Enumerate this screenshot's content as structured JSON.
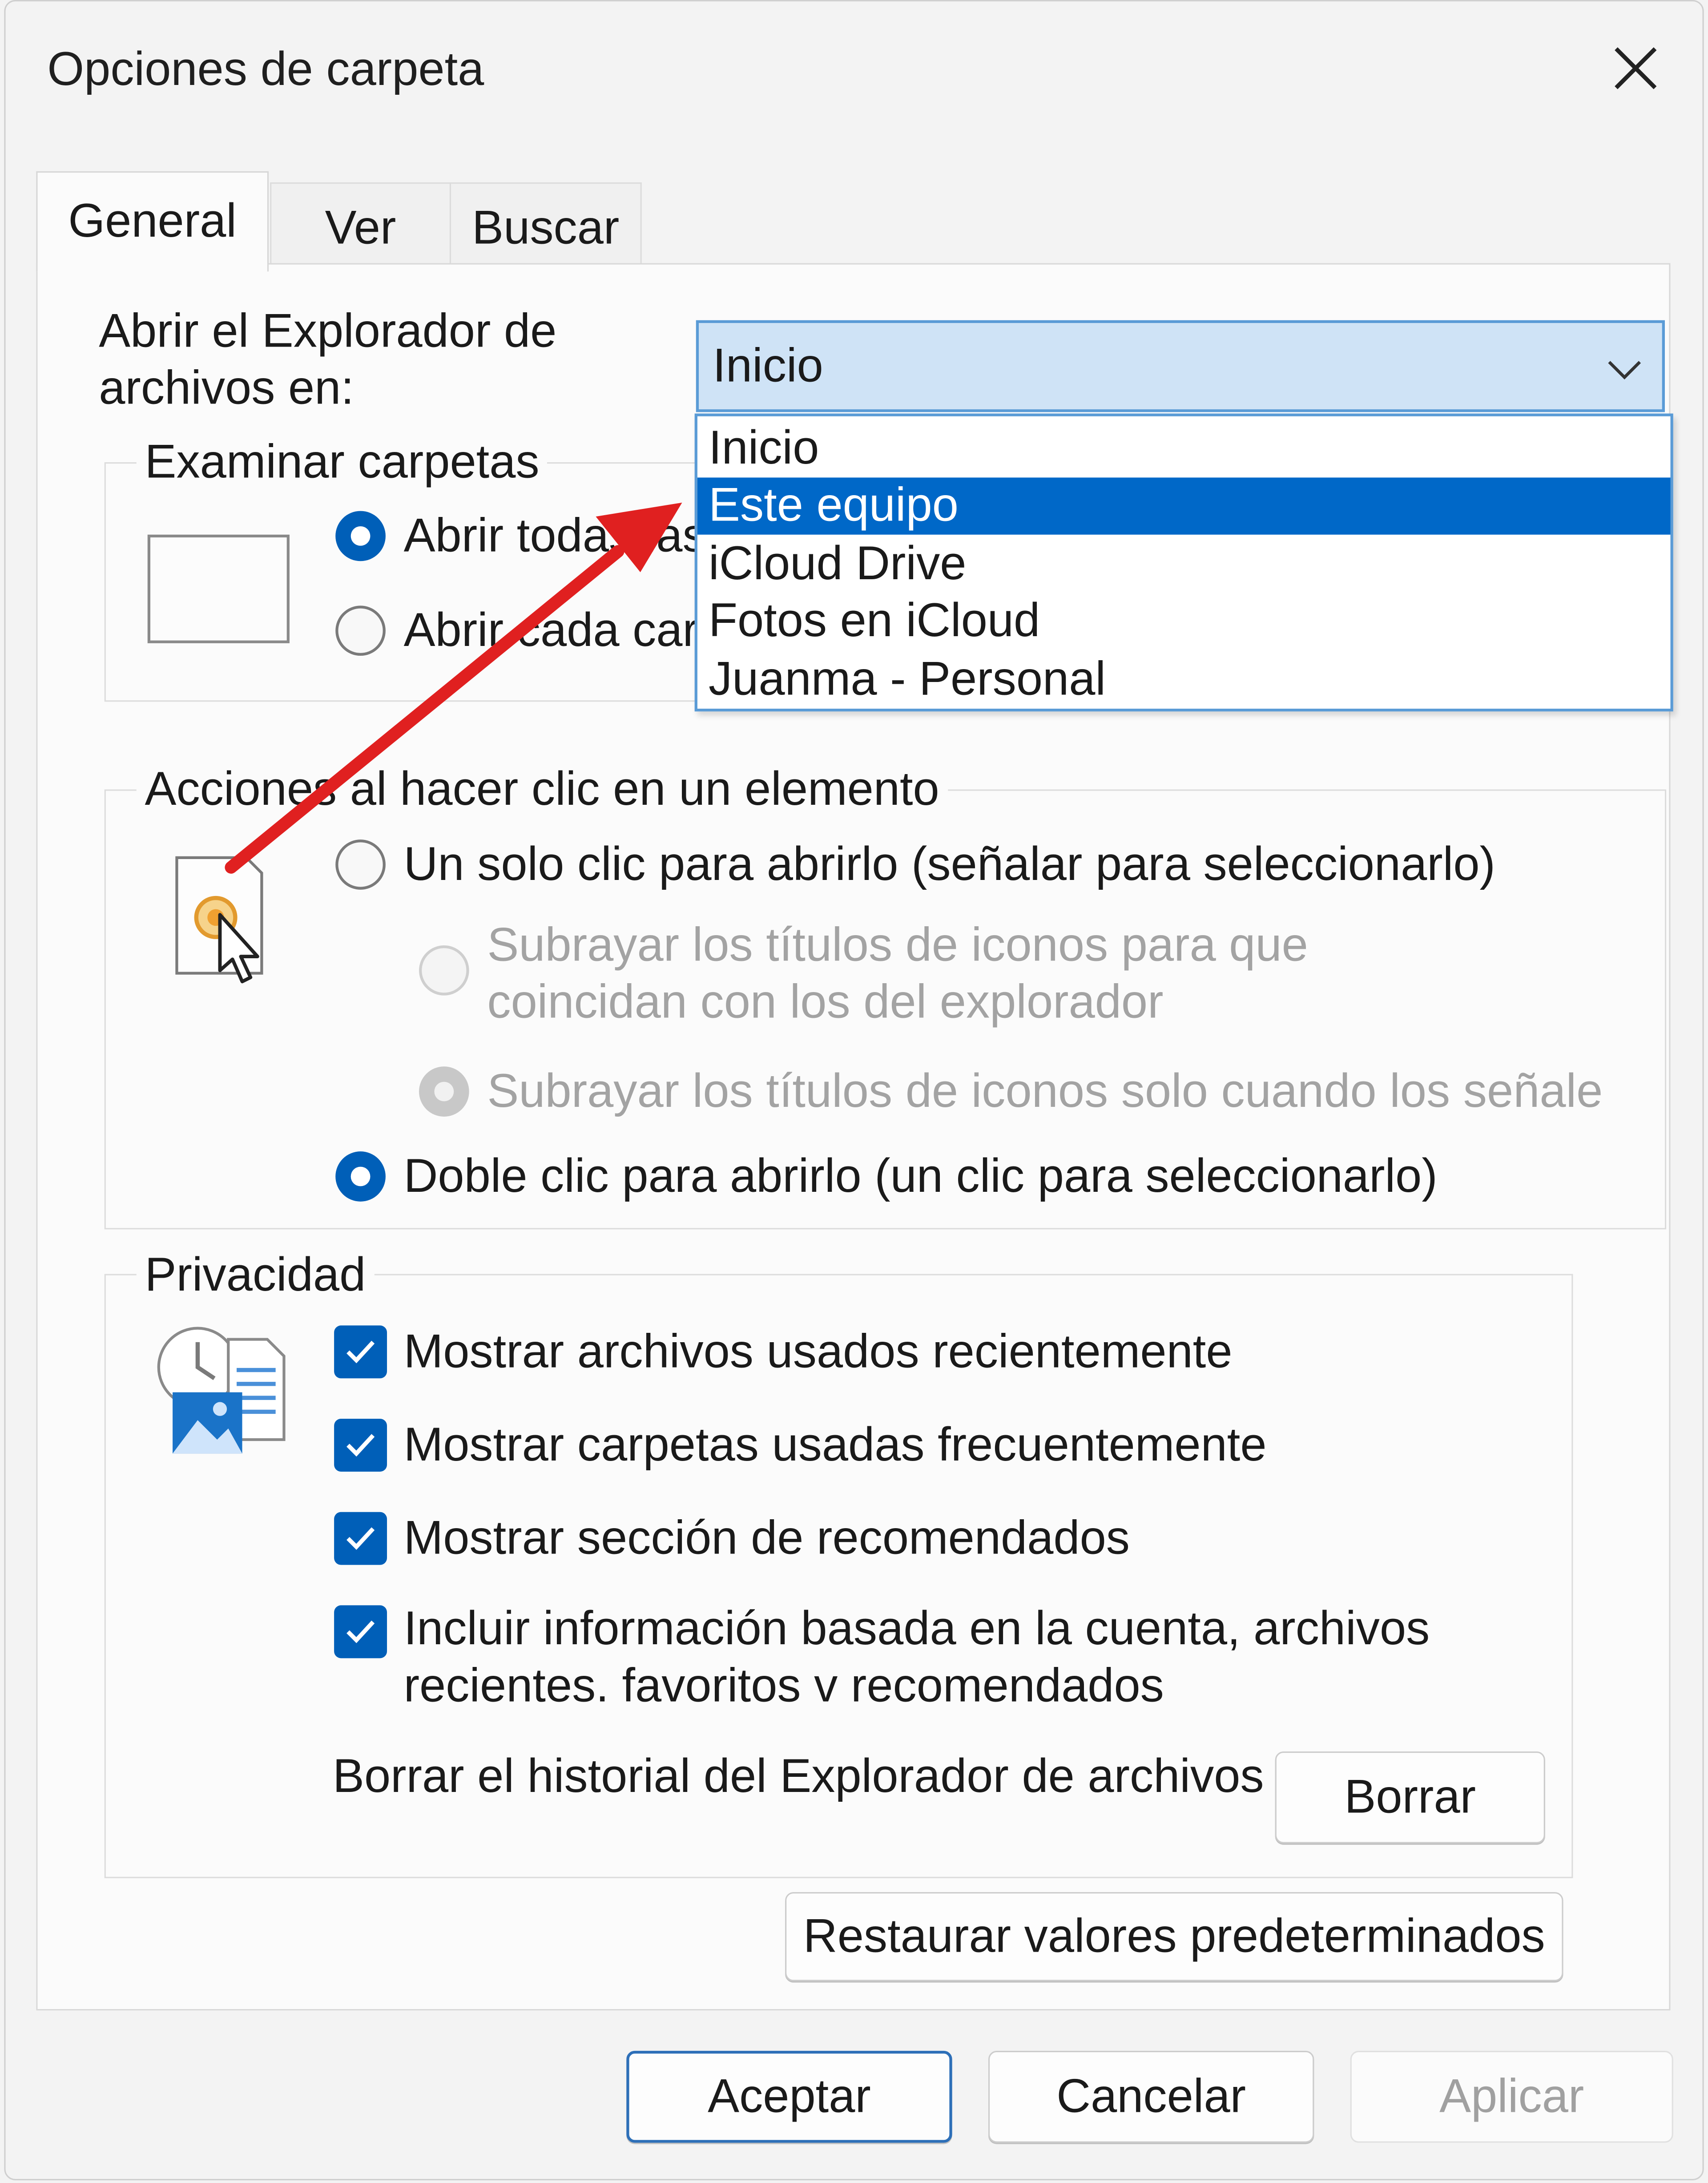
{
  "window": {
    "title": "Opciones de carpeta"
  },
  "tabs": [
    {
      "label": "General",
      "active": true
    },
    {
      "label": "Ver",
      "active": false
    },
    {
      "label": "Buscar",
      "active": false
    }
  ],
  "open_explorer": {
    "label_line1": "Abrir el Explorador de",
    "label_line2": "archivos en:",
    "selected": "Inicio",
    "options": [
      "Inicio",
      "Este equipo",
      "iCloud Drive",
      "Fotos en iCloud",
      "Juanma - Personal"
    ],
    "highlighted": "Este equipo"
  },
  "browse": {
    "title": "Examinar carpetas",
    "opt_same_window": "Abrir todas las",
    "opt_new_window": "Abrir cada car"
  },
  "click_actions": {
    "title": "Acciones al hacer clic en un elemento",
    "single_click": "Un solo clic para abrirlo (señalar para seleccionarlo)",
    "underline_browser_line1": "Subrayar los títulos de iconos para que",
    "underline_browser_line2": "coincidan con los del explorador",
    "underline_point": "Subrayar los títulos de iconos solo cuando los señale",
    "double_click": "Doble clic para abrirlo (un clic para seleccionarlo)"
  },
  "privacy": {
    "title": "Privacidad",
    "show_recent_files": "Mostrar archivos usados recientemente",
    "show_frequent_folders": "Mostrar carpetas usadas frecuentemente",
    "show_recommended": "Mostrar sección de recomendados",
    "include_account_line1": "Incluir información basada en la cuenta, archivos",
    "include_account_line2": "recientes. favoritos v recomendados",
    "clear_history_label": "Borrar el historial del Explorador de archivos",
    "clear_button": "Borrar"
  },
  "buttons": {
    "restore_defaults": "Restaurar valores predeterminados",
    "ok": "Aceptar",
    "cancel": "Cancelar",
    "apply": "Aplicar"
  },
  "colors": {
    "accent": "#005fb8",
    "selection": "#0068c8",
    "arrow": "#e02020"
  }
}
